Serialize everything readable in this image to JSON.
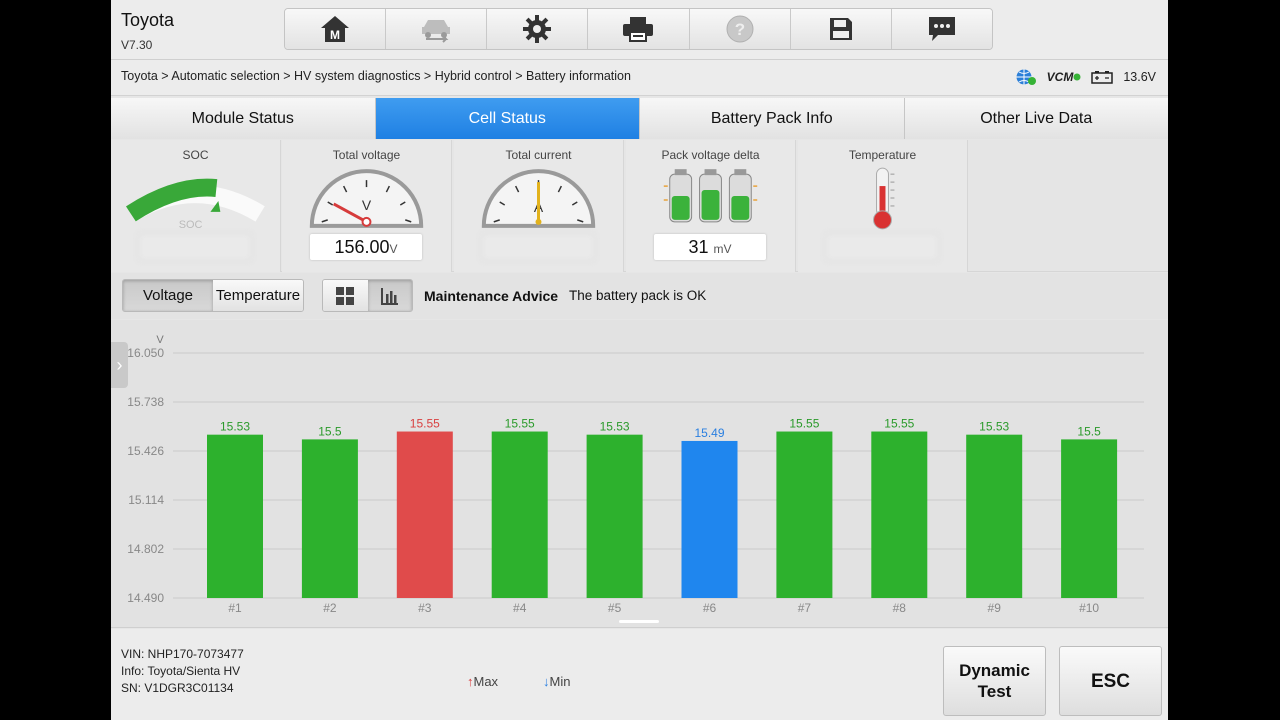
{
  "header": {
    "title": "Toyota",
    "version": "V7.30",
    "toolbar": [
      "home-icon",
      "vehicle-swap-icon",
      "gear-icon",
      "printer-icon",
      "help-icon",
      "save-icon",
      "message-icon"
    ]
  },
  "breadcrumb": "Toyota > Automatic selection > HV system diagnostics > Hybrid control > Battery information",
  "status": {
    "vcm_label": "VCM",
    "voltage": "13.6V"
  },
  "tabs": [
    {
      "label": "Module Status",
      "active": false
    },
    {
      "label": "Cell Status",
      "active": true
    },
    {
      "label": "Battery Pack Info",
      "active": false
    },
    {
      "label": "Other Live Data",
      "active": false
    }
  ],
  "gauges": {
    "soc": {
      "label": "SOC",
      "gauge_text": "SOC"
    },
    "total_voltage": {
      "label": "Total voltage",
      "dial_unit": "V",
      "value": "156.00",
      "unit": "V"
    },
    "total_current": {
      "label": "Total current",
      "dial_unit": "A"
    },
    "pack_delta": {
      "label": "Pack voltage delta",
      "value": "31",
      "unit": "mV"
    },
    "temperature": {
      "label": "Temperature"
    }
  },
  "controls": {
    "voltage_label": "Voltage",
    "temperature_label": "Temperature",
    "selected": "Voltage",
    "view_mode": "bar-chart",
    "advice_title": "Maintenance Advice",
    "advice_text": "The battery pack is OK"
  },
  "chart_data": {
    "type": "bar",
    "ylabel": "V",
    "ylim": [
      14.49,
      16.05
    ],
    "yticks": [
      "16.050",
      "15.738",
      "15.426",
      "15.114",
      "14.802",
      "14.490"
    ],
    "categories": [
      "#1",
      "#2",
      "#3",
      "#4",
      "#5",
      "#6",
      "#7",
      "#8",
      "#9",
      "#10"
    ],
    "values": [
      15.53,
      15.5,
      15.55,
      15.55,
      15.53,
      15.49,
      15.55,
      15.55,
      15.53,
      15.5
    ],
    "value_labels": [
      "15.53",
      "15.5",
      "15.55",
      "15.55",
      "15.53",
      "15.49",
      "15.55",
      "15.55",
      "15.53",
      "15.5"
    ],
    "max_index": 2,
    "min_index": 5,
    "colors": {
      "normal": "#2db12d",
      "max": "#e04b4b",
      "min": "#1f86ee",
      "label_normal": "#2a9a2a",
      "label_max": "#d94040",
      "label_min": "#2a7fe0"
    }
  },
  "footer": {
    "vin": "VIN: NHP170-7073477",
    "info": "Info: Toyota/Sienta HV",
    "sn": "SN: V1DGR3C01134",
    "legend_max": "Max",
    "legend_min": "Min",
    "dynamic_test_line1": "Dynamic",
    "dynamic_test_line2": "Test",
    "esc_label": "ESC"
  }
}
